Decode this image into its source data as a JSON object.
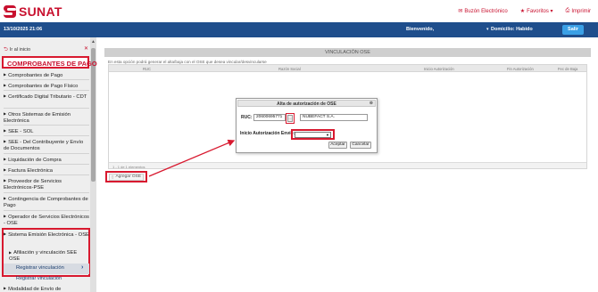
{
  "header": {
    "brand": "SUNAT",
    "links": [
      {
        "icon": "mail-icon",
        "glyph": "✉",
        "label": "Buzón Electrónico"
      },
      {
        "icon": "star-icon",
        "glyph": "★",
        "label": "Favoritos ▾"
      },
      {
        "icon": "print-icon",
        "glyph": "⎙",
        "label": "Imprimir"
      }
    ]
  },
  "session_bar": {
    "datetime": "13/10/2025 21:06",
    "welcome": "Bienvenido,",
    "caret": "▾",
    "domicilio": "Domicilio: Habido",
    "logout": "Salir"
  },
  "sidebar": {
    "back_label": "Ir al inicio",
    "close_glyph": "✕",
    "section_title": "COMPROBANTES DE PAGO",
    "items": [
      "Comprobantes de Pago",
      "Comprobantes de Pago Físico",
      "Certificado Digital Tributario - CDT",
      "Otros Sistemas de Emisión Electrónica",
      "SEE - SOL",
      "SEE - Del Contribuyente y Envío de Documentos",
      "Liquidación de Compra",
      "Factura Electrónica",
      "Proveedor de Servicios Electrónicos-PSE",
      "Contingencia de Comprobantes de Pago",
      "Operador de Servicios Electrónicos - OSE"
    ],
    "expanded_item": "Sistema Emisión Electrónica - OSE",
    "sub_item": "Afiliación y vinculación SEE OSE",
    "selected_item": "Registrar vinculación",
    "plain_item": "Registrar vinculación",
    "last_item": "Modalidad de Envío de"
  },
  "main": {
    "panel_title": "VINCULACIÓN OSE",
    "description": "En esta opción podrá generar el alta/baja con el OSE que desea vincular/desvincularse",
    "columns": [
      "RUC",
      "Razón Social",
      "Inicio Autorización",
      "Fin Autorización",
      "Fec de Baja"
    ],
    "footer": "1 - 1 de 1 elementos",
    "add_button": "Agregar OSE"
  },
  "dialog": {
    "title": "Alta de autorización de OSE",
    "ruc_label": "RUC:",
    "ruc_value": "20600695771",
    "lookup_label": "...",
    "name_value": "NUBEFACT S.A.",
    "start_label": "Inicio Autorización Envío:",
    "start_value": "",
    "accept": "Aceptar",
    "cancel": "Cancelar"
  },
  "colors": {
    "brand_red": "#c8102e",
    "bar_blue": "#1f4e8c",
    "logout_blue": "#3aa0e6",
    "highlight_red": "#d8192f"
  }
}
